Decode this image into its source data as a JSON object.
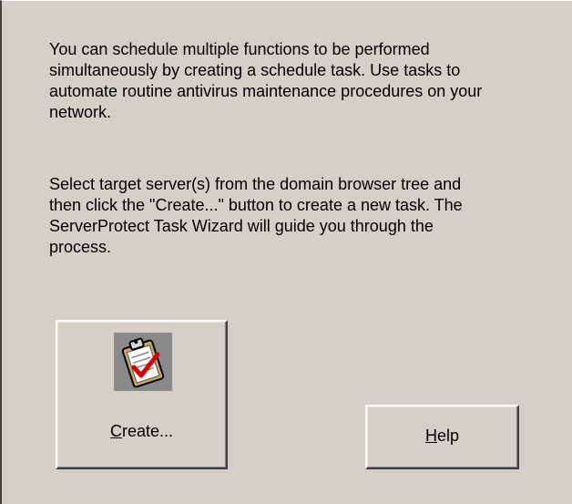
{
  "window": {
    "background": "#d4d0c8"
  },
  "intro": {
    "paragraph1": "You can schedule multiple functions to be performed\nsimultaneously by creating a schedule task. Use tasks to\nautomate routine antivirus maintenance procedures on your\nnetwork.",
    "paragraph2": "Select target server(s) from the domain browser tree and\nthen click the \"Create...\" button to create a new task. The\nServerProtect Task Wizard will guide you through the\nprocess."
  },
  "buttons": {
    "create": {
      "mnemonic": "C",
      "rest": "reate...",
      "icon": "task-clipboard-icon"
    },
    "help": {
      "mnemonic": "H",
      "rest": "elp"
    }
  }
}
